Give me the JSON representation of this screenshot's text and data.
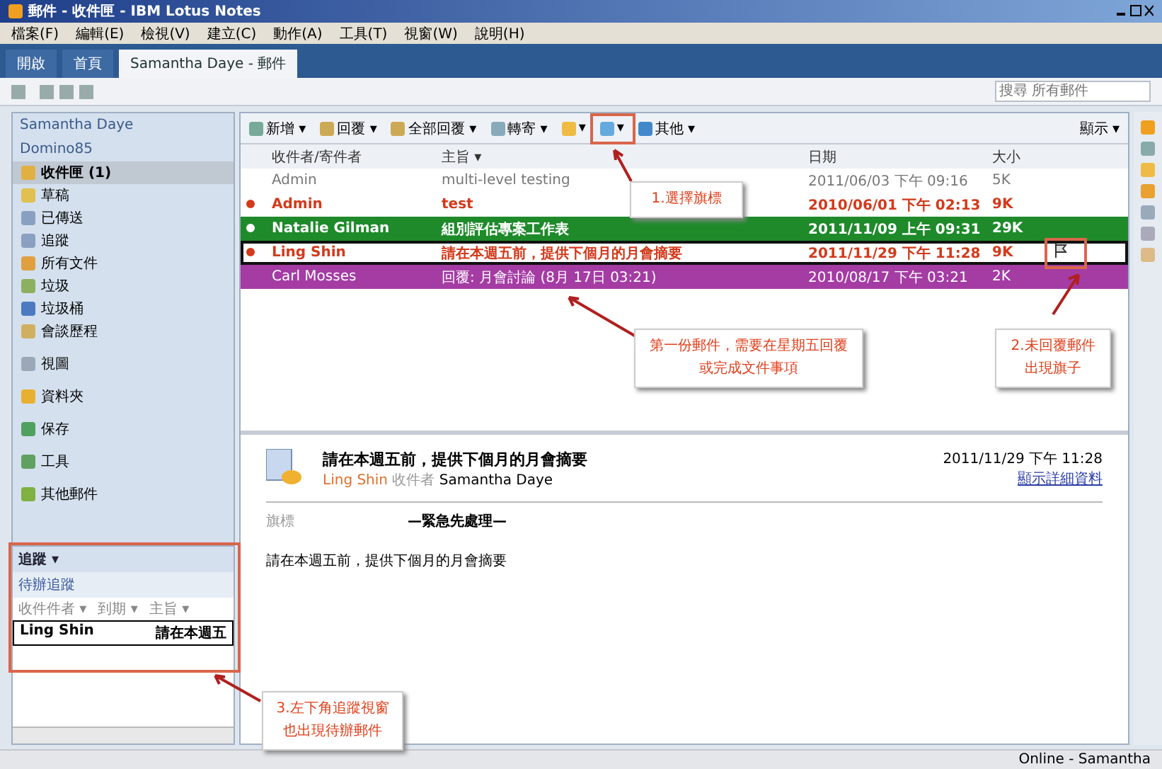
{
  "window": {
    "title": "郵件 - 收件匣 - IBM Lotus Notes"
  },
  "menu": [
    "檔案(F)",
    "編輯(E)",
    "檢視(V)",
    "建立(C)",
    "動作(A)",
    "工具(T)",
    "視窗(W)",
    "說明(H)"
  ],
  "tabs": [
    {
      "label": "開啟",
      "selected": false
    },
    {
      "label": "首頁",
      "selected": false
    },
    {
      "label": "Samantha Daye - 郵件",
      "selected": true
    }
  ],
  "search": {
    "placeholder": "搜尋 所有郵件"
  },
  "sidebar": {
    "owner": "Samantha Daye",
    "server": "Domino85",
    "items": [
      {
        "label": "收件匣 (1)",
        "selected": true
      },
      {
        "label": "草稿",
        "selected": false
      },
      {
        "label": "已傳送",
        "selected": false
      },
      {
        "label": "追蹤",
        "selected": false
      },
      {
        "label": "所有文件",
        "selected": false
      },
      {
        "label": "垃圾",
        "selected": false
      },
      {
        "label": "垃圾桶",
        "selected": false
      },
      {
        "label": "會談歷程",
        "selected": false
      },
      {
        "label": "視圖",
        "selected": false
      },
      {
        "label": "資料夾",
        "selected": false
      },
      {
        "label": "保存",
        "selected": false
      },
      {
        "label": "工具",
        "selected": false
      },
      {
        "label": "其他郵件",
        "selected": false
      }
    ],
    "follow_up": {
      "title": "追蹤 ▾",
      "subtitle": "待辦追蹤",
      "columns": [
        "收件件者 ▾",
        "到期 ▾",
        "主旨 ▾"
      ],
      "rows": [
        {
          "sender": "Ling Shin",
          "subject": "請在本週五"
        }
      ]
    }
  },
  "toolbar": {
    "items": [
      "新增 ▾",
      "回覆 ▾",
      "全部回覆 ▾",
      "轉寄 ▾",
      "▾",
      "▾",
      "其他 ▾"
    ],
    "display": "顯示 ▾"
  },
  "table": {
    "columns": [
      "收件者/寄件者",
      "主旨 ▾",
      "日期",
      "大小"
    ],
    "rows": [
      {
        "sender": "Admin",
        "subject": "multi-level testing",
        "date": "2011/06/03 下午 09:16",
        "size": "5K",
        "unread": false,
        "flagged": false,
        "selected": false
      },
      {
        "sender": "Admin",
        "subject": "test",
        "date": "2010/06/01 下午 02:13",
        "size": "9K",
        "unread": true,
        "flagged": false,
        "selected": false
      },
      {
        "sender": "Natalie Gilman",
        "subject": "組別評估專案工作表",
        "date": "2011/11/09 上午 09:31",
        "size": "29K",
        "unread": true,
        "flagged": false,
        "selected": false,
        "color": "#1e8a2a"
      },
      {
        "sender": "Ling Shin",
        "subject": "請在本週五前，提供下個月的月會摘要",
        "date": "2011/11/29 下午 11:28",
        "size": "9K",
        "unread": true,
        "flagged": true,
        "selected": true
      },
      {
        "sender": "Carl Mosses",
        "subject": "回覆: 月會討論 (8月 17日 03:21)",
        "date": "2010/08/17 下午 03:21",
        "size": "2K",
        "unread": false,
        "flagged": false,
        "selected": false,
        "color": "#a43ca4"
      }
    ]
  },
  "preview": {
    "subject": "請在本週五前，提供下個月的月會摘要",
    "from": "Ling Shin",
    "to_label": "收件者",
    "to": "Samantha Daye",
    "date": "2011/11/29 下午 11:28",
    "details_link": "顯示詳細資料",
    "field_label": "旗標",
    "field_value": "—緊急先處理—",
    "body": "請在本週五前，提供下個月的月會摘要"
  },
  "callouts": [
    {
      "text": "1.選擇旗標"
    },
    {
      "text": "第一份郵件，需要在星期五回覆或完成文件事項"
    },
    {
      "text": "2.未回覆郵件出現旗子"
    },
    {
      "text": "3.左下角追蹤視窗也出現待辦郵件"
    }
  ],
  "status_bar": {
    "user": "Online - Samantha"
  }
}
